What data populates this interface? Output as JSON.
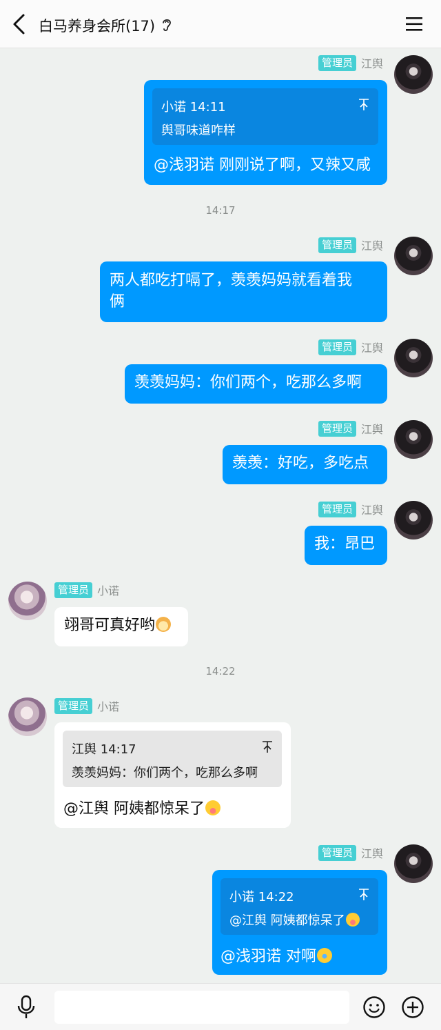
{
  "header": {
    "title": "白马养身会所(17)",
    "back_icon": "back-arrow-icon",
    "ear_icon": "ear-icon",
    "menu_icon": "hamburger-menu-icon"
  },
  "badge_label": "管理员",
  "colors": {
    "outgoing_bubble": "#0099ff",
    "incoming_bubble": "#ffffff",
    "badge": "#46cfd3",
    "background": "#eef1ef"
  },
  "messages": [
    {
      "sender": "江舆",
      "quote": {
        "header": "小诺 14:11",
        "text": "舆哥味道咋样"
      },
      "text": "@浅羽诺 刚刚说了啊，又辣又咸"
    },
    {
      "timestamp": "14:17"
    },
    {
      "sender": "江舆",
      "line1": "两人都吃打嗝了，羡羡妈妈就看着我",
      "line2": "俩"
    },
    {
      "sender": "江舆",
      "text": "羡羡妈妈：你们两个，吃那么多啊"
    },
    {
      "sender": "江舆",
      "text": "羡羡：好吃，多吃点"
    },
    {
      "sender": "江舆",
      "text": "我：昂巴"
    },
    {
      "sender": "小诺",
      "text": "翊哥可真好哟",
      "emoji": "hamster-emoji"
    },
    {
      "timestamp": "14:22"
    },
    {
      "sender": "小诺",
      "quote": {
        "header": "江舆 14:17",
        "text": "羡羡妈妈：你们两个，吃那么多啊"
      },
      "text": "@江舆 阿姨都惊呆了",
      "emoji": "tongue-emoji"
    },
    {
      "sender": "江舆",
      "quote": {
        "header": "小诺 14:22",
        "text": "@江舆 阿姨都惊呆了",
        "emoji": "tongue-emoji"
      },
      "text": "@浅羽诺 对啊",
      "emoji": "laugh-emoji"
    }
  ],
  "input_bar": {
    "mic_icon": "microphone-icon",
    "placeholder": "",
    "emoji_icon": "smiley-icon",
    "plus_icon": "plus-circle-icon"
  }
}
